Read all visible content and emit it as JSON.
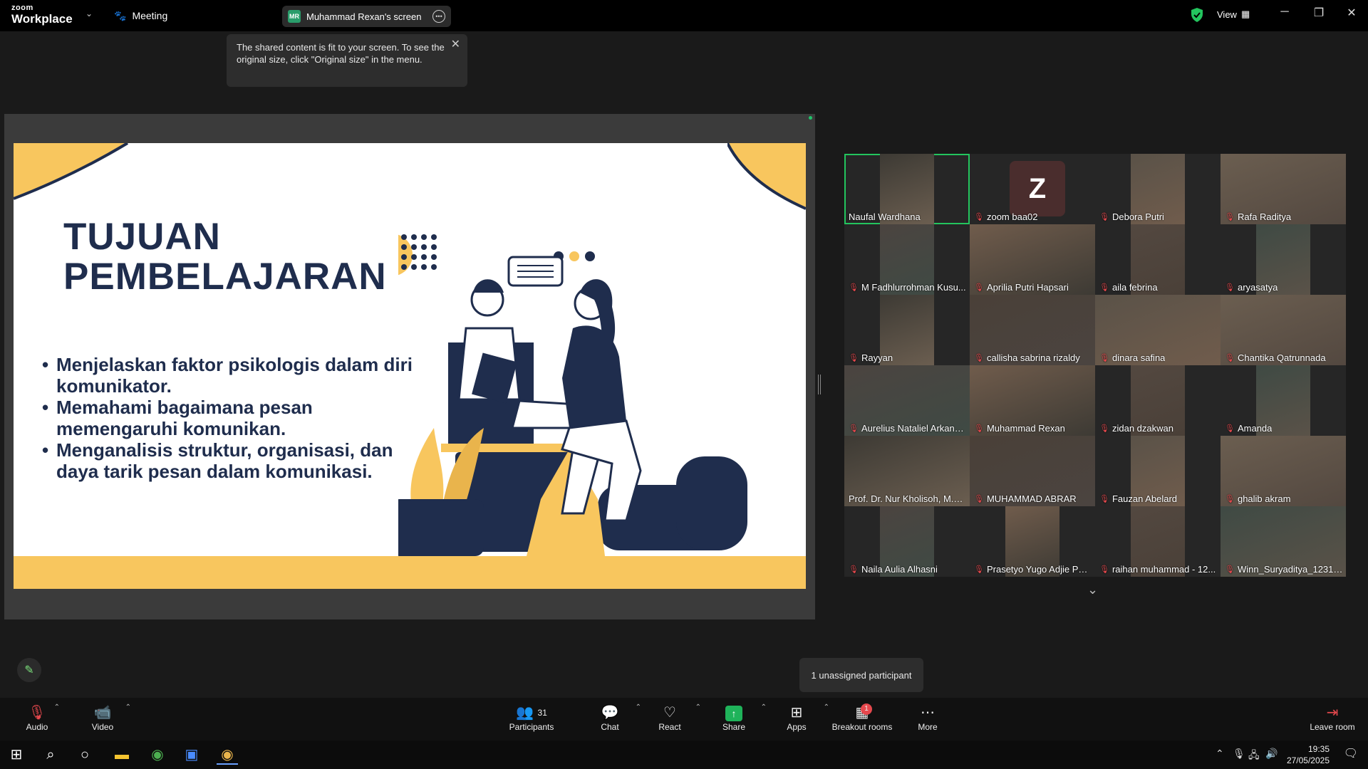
{
  "app": {
    "logo_line1": "zoom",
    "logo_line2": "Workplace",
    "meeting_label": "Meeting",
    "presenter_initials": "MR",
    "screen_label": "Muhammad Rexan's screen",
    "view_label": "View",
    "accent_color": "#23c55e"
  },
  "tooltip": {
    "text": "The shared content is fit to your screen. To see the original size, click \"Original size\" in the menu."
  },
  "slide": {
    "title_line1": "TUJUAN",
    "title_line2": "PEMBELAJARAN",
    "bullets": [
      "Menjelaskan faktor psikologis dalam diri komunikator.",
      "Memahami bagaimana pesan memengaruhi komunikan.",
      "Menganalisis struktur, organisasi, dan daya tarik pesan dalam komunikasi."
    ],
    "colors": {
      "navy": "#1f2d4d",
      "yellow": "#f8c65e"
    }
  },
  "gallery": {
    "participants": [
      {
        "name": "Naufal Wardhana",
        "muted": false,
        "active": true
      },
      {
        "name": "zoom baa02",
        "muted": true,
        "avatar": "Z"
      },
      {
        "name": "Debora Putri",
        "muted": true
      },
      {
        "name": "Rafa Raditya",
        "muted": true
      },
      {
        "name": "M Fadhlurrohman Kusu...",
        "muted": true
      },
      {
        "name": "Aprilia Putri Hapsari",
        "muted": true
      },
      {
        "name": "aila febrina",
        "muted": true
      },
      {
        "name": "aryasatya",
        "muted": true
      },
      {
        "name": "Rayyan",
        "muted": true
      },
      {
        "name": "callisha sabrina rizaldy",
        "muted": true
      },
      {
        "name": "dinara safina",
        "muted": true
      },
      {
        "name": "Chantika Qatrunnada",
        "muted": true
      },
      {
        "name": "Aurelius Nataliel Arkana...",
        "muted": true
      },
      {
        "name": "Muhammad Rexan",
        "muted": true
      },
      {
        "name": "zidan dzakwan",
        "muted": true
      },
      {
        "name": "Amanda",
        "muted": true
      },
      {
        "name": "Prof. Dr. Nur Kholisoh, M.Si...",
        "muted": false
      },
      {
        "name": "MUHAMMAD ABRAR",
        "muted": true
      },
      {
        "name": "Fauzan Abelard",
        "muted": true
      },
      {
        "name": "ghalib akram",
        "muted": true
      },
      {
        "name": "Naila Aulia Alhasni",
        "muted": true
      },
      {
        "name": "Prasetyo Yugo Adjie Pan...",
        "muted": true
      },
      {
        "name": "raihan muhammad - 12...",
        "muted": true
      },
      {
        "name": "Winn_Suryaditya_123100...",
        "muted": true
      }
    ]
  },
  "unassigned_label": "1 unassigned participant",
  "toolbar": {
    "audio": "Audio",
    "video": "Video",
    "participants_count": "31",
    "participants": "Participants",
    "chat": "Chat",
    "react": "React",
    "share": "Share",
    "apps": "Apps",
    "breakout": "Breakout rooms",
    "breakout_badge": "1",
    "more": "More",
    "leave": "Leave room"
  },
  "taskbar": {
    "time": "19:35",
    "date": "27/05/2025"
  }
}
